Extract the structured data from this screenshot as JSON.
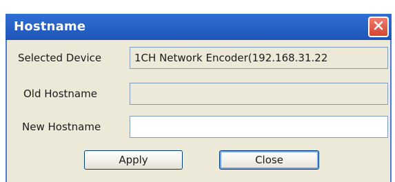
{
  "window": {
    "title": "Hostname",
    "close_icon": "close-x-icon"
  },
  "form": {
    "selected_device_label": "Selected Device",
    "selected_device_value": "1CH Network Encoder(192.168.31.22",
    "old_hostname_label": "Old Hostname",
    "old_hostname_value": "",
    "new_hostname_label": "New Hostname",
    "new_hostname_value": ""
  },
  "buttons": {
    "apply_label": "Apply",
    "close_label": "Close"
  },
  "colors": {
    "titlebar": "#1f55b8",
    "client_bg": "#ece9d8",
    "close_button": "#d6452f"
  }
}
